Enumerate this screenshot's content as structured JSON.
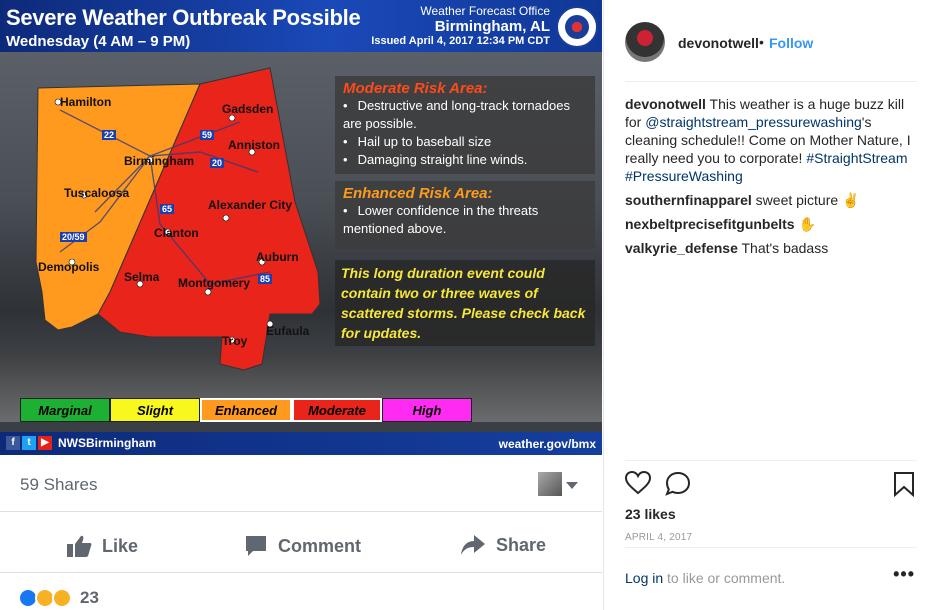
{
  "weather_graphic": {
    "title": "Severe Weather Outbreak Possible",
    "subtitle": "Wednesday (4 AM – 9 PM)",
    "office_line1": "Weather Forecast Office",
    "office_line2": "Birmingham, AL",
    "issued": "Issued April 4, 2017 12:34 PM CDT",
    "cities": [
      "Hamilton",
      "Gadsden",
      "Birmingham",
      "Anniston",
      "Tuscaloosa",
      "Alexander City",
      "Clanton",
      "Demopolis",
      "Selma",
      "Montgomery",
      "Auburn",
      "Eufaula",
      "Troy"
    ],
    "roads": [
      "22",
      "59",
      "20",
      "65",
      "20/59",
      "85"
    ],
    "moderate_title": "Moderate Risk Area:",
    "moderate_items": [
      "Destructive and long-track tornadoes are possible.",
      "Hail up to baseball size",
      "Damaging straight line winds."
    ],
    "enhanced_title": "Enhanced Risk Area:",
    "enhanced_items": [
      "Lower confidence in the threats mentioned above."
    ],
    "long_duration_text": "This long duration event could contain two or three waves of scattered storms. Please check back for updates.",
    "legend": [
      {
        "label": "Marginal",
        "color": "#1db134"
      },
      {
        "label": "Slight",
        "color": "#f8f81e"
      },
      {
        "label": "Enhanced",
        "color": "#ff9a1f"
      },
      {
        "label": "Moderate",
        "color": "#e8241b"
      },
      {
        "label": "High",
        "color": "#ff2bf3"
      }
    ],
    "footer_left": "NWSBirmingham",
    "footer_right": "weather.gov/bmx"
  },
  "fb": {
    "shares": "59 Shares",
    "like": "Like",
    "comment": "Comment",
    "share": "Share",
    "reaction_count": "23"
  },
  "ig": {
    "username": "devonotwell",
    "follow": "Follow",
    "caption_user": "devonotwell",
    "caption_part1": " This weather is a huge buzz kill for ",
    "caption_mention": "@straightstream_pressurewashing",
    "caption_part2": "'s cleaning schedule!! Come on Mother Nature, I really need you to corporate! ",
    "caption_tag1": "#StraightStream",
    "caption_tag2": "#PressureWashing",
    "comments": [
      {
        "user": "southernfinapparel",
        "text": " sweet picture ✌"
      },
      {
        "user": "nexbeltprecisefitgunbelts",
        "text": " ✋"
      },
      {
        "user": "valkyrie_defense",
        "text": " That's badass"
      }
    ],
    "likes": "23 likes",
    "date": "APRIL 4, 2017",
    "login_link": "Log in",
    "login_rest": " to like or comment.",
    "more": "•••"
  },
  "colors": {
    "enhanced": "#ff9a1f",
    "moderate": "#e8241b",
    "ig_blue": "#3897f0"
  }
}
